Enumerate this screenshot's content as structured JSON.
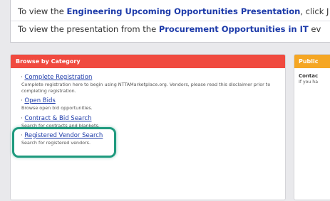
{
  "notice": {
    "line1": {
      "prefix": "To view the ",
      "link": "Engineering Upcoming Opportunities Presentation",
      "suffix": ", click J"
    },
    "line2": {
      "prefix": "To view the presentation from the ",
      "link": "Procurement Opportunities in IT",
      "suffix": " ev"
    }
  },
  "browse": {
    "header": "Browse by Category",
    "items": [
      {
        "label": "Complete Registration",
        "desc": "Complete registration here to begin using NTTAMarketplace.org. Vendors, please read this disclaimer prior to completing registration."
      },
      {
        "label": "Open Bids",
        "desc": "Browse open bid opportunities."
      },
      {
        "label": "Contract & Bid Search",
        "desc": "Search for contracts and blankets."
      },
      {
        "label": "Registered Vendor Search",
        "desc": "Search for registered vendors."
      }
    ],
    "bullet": "·"
  },
  "public_panel": {
    "header": "Public",
    "title": "Contac",
    "desc": "If you ha"
  },
  "colors": {
    "browse_header": "#f04a3f",
    "public_header": "#f5a623",
    "link": "#1c3aa9",
    "highlight": "#1e9a7e"
  }
}
